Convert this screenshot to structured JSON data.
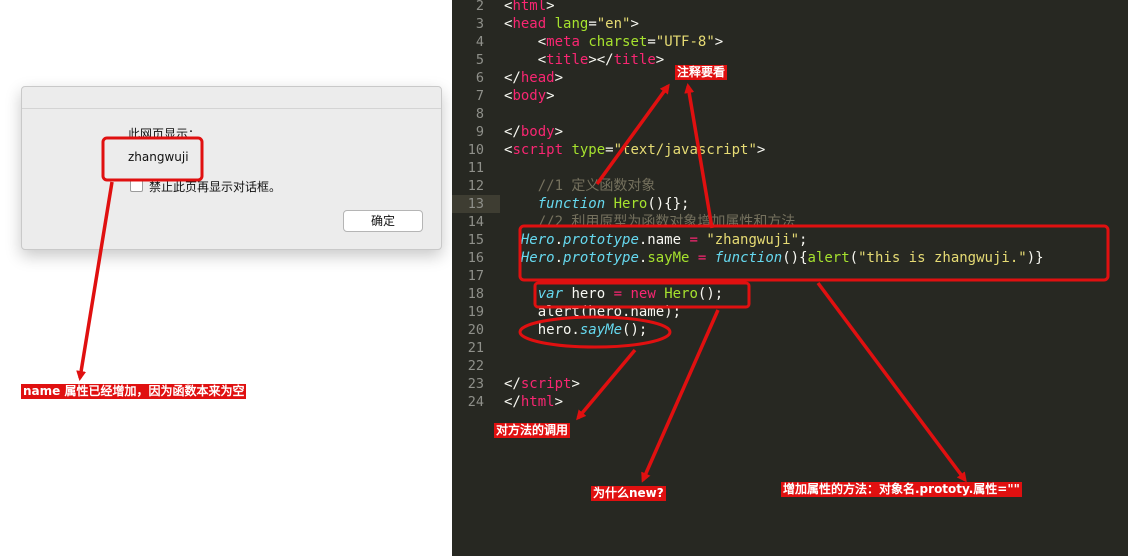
{
  "dialog": {
    "heading": "此网页显示：",
    "message": "zhangwuji",
    "checkbox_label": "禁止此页再显示对话框。",
    "ok_label": "确定"
  },
  "editor": {
    "lines": [
      {
        "n": "2",
        "tokens": [
          [
            "t-plain",
            "<"
          ],
          [
            "t-tag",
            "html"
          ],
          [
            "t-plain",
            ">"
          ]
        ]
      },
      {
        "n": "3",
        "tokens": [
          [
            "t-plain",
            "<"
          ],
          [
            "t-tag",
            "head"
          ],
          [
            "t-plain",
            " "
          ],
          [
            "t-attr",
            "lang"
          ],
          [
            "t-plain",
            "="
          ],
          [
            "t-str",
            "\"en\""
          ],
          [
            "t-plain",
            ">"
          ]
        ]
      },
      {
        "n": "4",
        "tokens": [
          [
            "t-plain",
            "    <"
          ],
          [
            "t-tag",
            "meta"
          ],
          [
            "t-plain",
            " "
          ],
          [
            "t-attr",
            "charset"
          ],
          [
            "t-plain",
            "="
          ],
          [
            "t-str",
            "\"UTF-8\""
          ],
          [
            "t-plain",
            ">"
          ]
        ]
      },
      {
        "n": "5",
        "tokens": [
          [
            "t-plain",
            "    <"
          ],
          [
            "t-tag",
            "title"
          ],
          [
            "t-plain",
            "></"
          ],
          [
            "t-tag",
            "title"
          ],
          [
            "t-plain",
            ">"
          ]
        ]
      },
      {
        "n": "6",
        "tokens": [
          [
            "t-plain",
            "</"
          ],
          [
            "t-tag",
            "head"
          ],
          [
            "t-plain",
            ">"
          ]
        ]
      },
      {
        "n": "7",
        "tokens": [
          [
            "t-plain",
            "<"
          ],
          [
            "t-tag",
            "body"
          ],
          [
            "t-plain",
            ">"
          ]
        ]
      },
      {
        "n": "8",
        "tokens": []
      },
      {
        "n": "9",
        "tokens": [
          [
            "t-plain",
            "</"
          ],
          [
            "t-tag",
            "body"
          ],
          [
            "t-plain",
            ">"
          ]
        ]
      },
      {
        "n": "10",
        "tokens": [
          [
            "t-plain",
            "<"
          ],
          [
            "t-tag",
            "script"
          ],
          [
            "t-plain",
            " "
          ],
          [
            "t-attr",
            "type"
          ],
          [
            "t-plain",
            "="
          ],
          [
            "t-str",
            "\"text/javascript\""
          ],
          [
            "t-plain",
            ">"
          ]
        ]
      },
      {
        "n": "11",
        "tokens": []
      },
      {
        "n": "12",
        "tokens": [
          [
            "t-cmt",
            "    //1 定义函数对象"
          ]
        ]
      },
      {
        "n": "13",
        "tokens": [
          [
            "t-kw",
            "    function"
          ],
          [
            "t-plain",
            " "
          ],
          [
            "t-fn",
            "Hero"
          ],
          [
            "t-plain",
            "(){};"
          ]
        ]
      },
      {
        "n": "14",
        "tokens": [
          [
            "t-cmt",
            "    //2 利用原型为函数对象增加属性和方法"
          ]
        ]
      },
      {
        "n": "15",
        "tokens": [
          [
            "t-type",
            "  Hero"
          ],
          [
            "t-plain",
            "."
          ],
          [
            "t-var",
            "prototype"
          ],
          [
            "t-plain",
            ".name "
          ],
          [
            "t-op",
            "="
          ],
          [
            "t-plain",
            " "
          ],
          [
            "t-str",
            "\"zhangwuji\""
          ],
          [
            "t-plain",
            ";"
          ]
        ]
      },
      {
        "n": "16",
        "tokens": [
          [
            "t-type",
            "  Hero"
          ],
          [
            "t-plain",
            "."
          ],
          [
            "t-var",
            "prototype"
          ],
          [
            "t-plain",
            "."
          ],
          [
            "t-fn",
            "sayMe"
          ],
          [
            "t-plain",
            " "
          ],
          [
            "t-op",
            "="
          ],
          [
            "t-plain",
            " "
          ],
          [
            "t-kw",
            "function"
          ],
          [
            "t-plain",
            "(){"
          ],
          [
            "t-fn",
            "alert"
          ],
          [
            "t-plain",
            "("
          ],
          [
            "t-str",
            "\"this is zhangwuji.\""
          ],
          [
            "t-plain",
            ")}"
          ]
        ]
      },
      {
        "n": "17",
        "tokens": []
      },
      {
        "n": "18",
        "tokens": [
          [
            "t-kw",
            "    var"
          ],
          [
            "t-plain",
            " hero "
          ],
          [
            "t-op",
            "="
          ],
          [
            "t-plain",
            " "
          ],
          [
            "t-op",
            "new"
          ],
          [
            "t-plain",
            " "
          ],
          [
            "t-fn",
            "Hero"
          ],
          [
            "t-plain",
            "();"
          ]
        ]
      },
      {
        "n": "19",
        "tokens": [
          [
            "t-plain",
            "    alert(hero.name);"
          ]
        ]
      },
      {
        "n": "20",
        "tokens": [
          [
            "t-plain",
            "    hero."
          ],
          [
            "t-var",
            "sayMe"
          ],
          [
            "t-plain",
            "();"
          ]
        ]
      },
      {
        "n": "21",
        "tokens": []
      },
      {
        "n": "22",
        "tokens": []
      },
      {
        "n": "23",
        "tokens": [
          [
            "t-plain",
            "</"
          ],
          [
            "t-tag",
            "script"
          ],
          [
            "t-plain",
            ">"
          ]
        ]
      },
      {
        "n": "24",
        "tokens": [
          [
            "t-plain",
            "</"
          ],
          [
            "t-tag",
            "html"
          ],
          [
            "t-plain",
            ">"
          ]
        ]
      }
    ],
    "highlighted_line": "13"
  },
  "annotations": {
    "name_added": "name 属性已经增加，因为函数本来为空",
    "see_comments": "注释要看",
    "method_call": "对方法的调用",
    "why_new": "为什么new?",
    "add_property": "增加属性的方法：对象名.prototy.属性=\"\""
  },
  "colors": {
    "annotation_red": "#e01010",
    "editor_bg": "#272822"
  }
}
